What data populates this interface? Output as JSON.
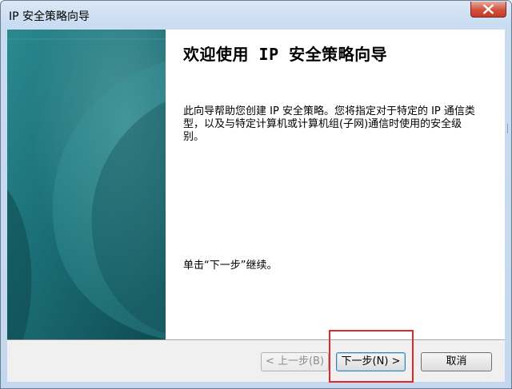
{
  "window": {
    "title": "IP 安全策略向导",
    "close_icon": "close-icon"
  },
  "wizard": {
    "heading": "欢迎使用 IP 安全策略向导",
    "description": "此向导帮助您创建 IP 安全策略。您将指定对于特定的 IP 通信类型，以及与特定计算机或计算机组(子网)通信时使用的安全级别。",
    "next_hint": "单击“下一步”继续。"
  },
  "buttons": {
    "back_label": "< 上一步(B)",
    "next_label": "下一步(N) >",
    "cancel_label": "取消"
  },
  "colors": {
    "side_panel_dark": "#0f4a52",
    "side_panel_light": "#2a8a8f",
    "highlight": "#e0282c"
  }
}
